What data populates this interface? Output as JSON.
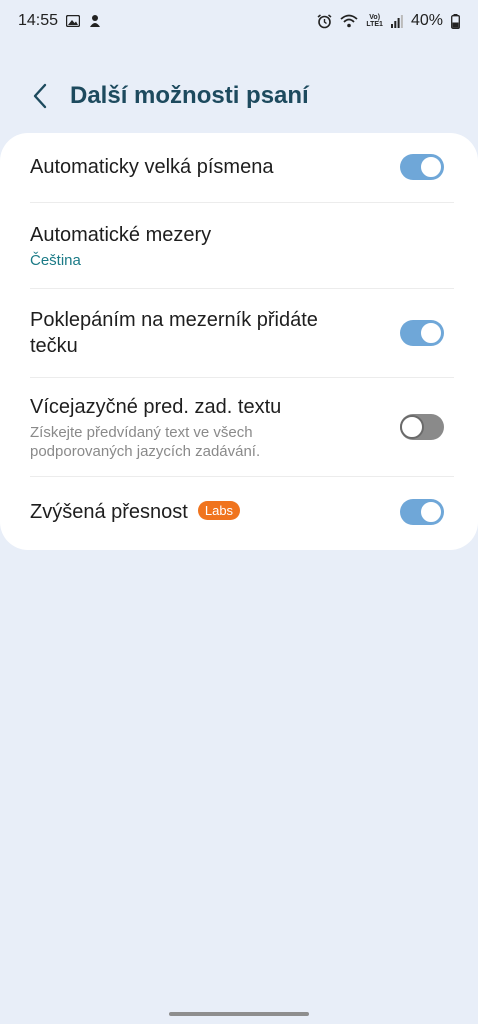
{
  "status_bar": {
    "time": "14:55",
    "battery": "40%",
    "volte_line1": "Vo)",
    "volte_line2": "LTE1",
    "icons": [
      "image-icon",
      "app-notification-icon",
      "alarm-icon",
      "wifi-icon",
      "volte-icon",
      "signal-icon",
      "battery-icon"
    ]
  },
  "header": {
    "title": "Další možnosti psaní",
    "back_icon": "chevron-left-icon"
  },
  "settings": [
    {
      "title": "Automaticky velká písmena",
      "subtitle": "",
      "toggle": true
    },
    {
      "title": "Automatické mezery",
      "subtitle": "Čeština",
      "toggle": null
    },
    {
      "title": "Poklepáním na mezerník přidáte tečku",
      "subtitle": "",
      "toggle": true
    },
    {
      "title": "Vícejazyčné pred. zad. textu",
      "subtitle": "Získejte předvídaný text ve všech podporovaných jazycích zadávání.",
      "toggle": false
    },
    {
      "title": "Zvýšená přesnost",
      "badge": "Labs",
      "subtitle": "",
      "toggle": true
    }
  ],
  "colors": {
    "background": "#e8eef8",
    "accent": "#6fa7d8",
    "title": "#1d4a5e",
    "subtitle_accent": "#1b7a86",
    "badge": "#f0741e"
  }
}
